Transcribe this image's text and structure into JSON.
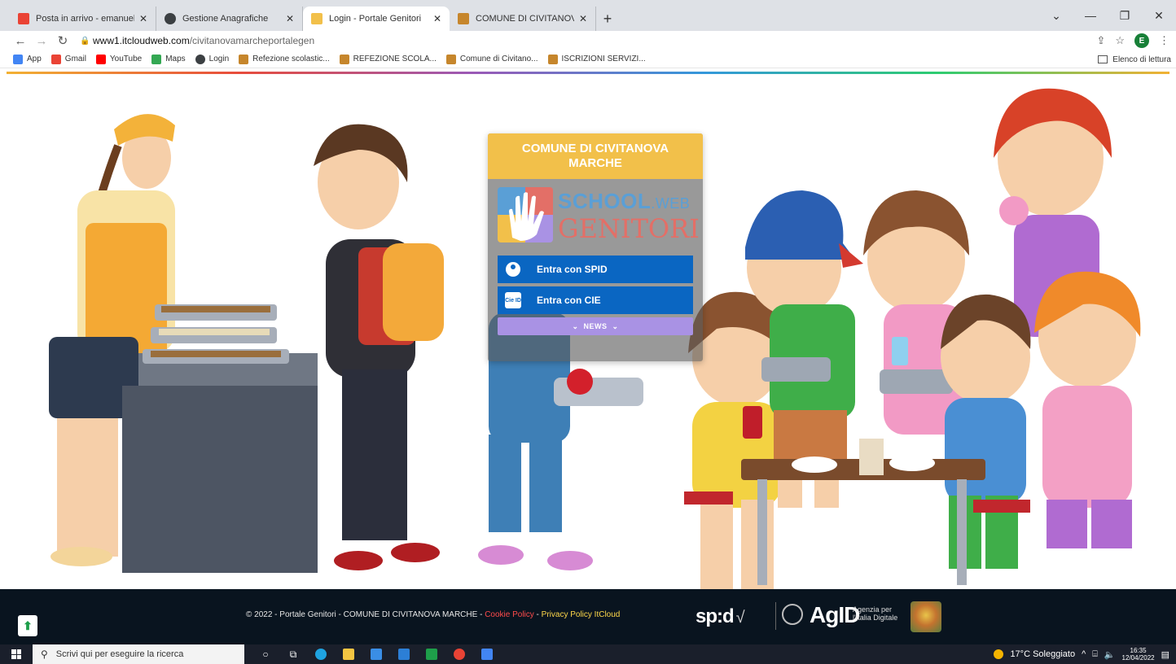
{
  "browser": {
    "tabs": [
      {
        "title": "Posta in arrivo - emanuela.torres",
        "favicon_color": "#ea4335",
        "icon": "gmail-icon"
      },
      {
        "title": "Gestione Anagrafiche",
        "favicon_color": "#3c4043",
        "icon": "globe-icon"
      },
      {
        "title": "Login - Portale Genitori",
        "favicon_color": "#f2c04a",
        "icon": "portal-icon"
      },
      {
        "title": "COMUNE DI CIVITANOVA MARC",
        "favicon_color": "#c6862c",
        "icon": "crest-icon"
      }
    ],
    "new_tab_label": "+",
    "url_host": "www1.itcloudweb.com",
    "url_path": "/civitanovamarcheportalegen",
    "profile_initial": "E",
    "bookmarks": [
      {
        "label": "App",
        "color": "#4285f4",
        "icon": "apps-icon"
      },
      {
        "label": "Gmail",
        "color": "#ea4335",
        "icon": "gmail-icon"
      },
      {
        "label": "YouTube",
        "color": "#ff0000",
        "icon": "youtube-icon"
      },
      {
        "label": "Maps",
        "color": "#34a853",
        "icon": "maps-icon"
      },
      {
        "label": "Login",
        "color": "#3c4043",
        "icon": "globe-icon"
      },
      {
        "label": "Refezione scolastic...",
        "color": "#c6862c",
        "icon": "crest-icon"
      },
      {
        "label": "REFEZIONE SCOLA...",
        "color": "#c6862c",
        "icon": "crest-icon"
      },
      {
        "label": "Comune di Civitano...",
        "color": "#c6862c",
        "icon": "crest-icon"
      },
      {
        "label": "ISCRIZIONI SERVIZI...",
        "color": "#c6862c",
        "icon": "crest-icon"
      }
    ],
    "reading_list_label": "Elenco di lettura"
  },
  "login_card": {
    "title": "COMUNE DI CIVITANOVA MARCHE",
    "logo_line1": "SCHOOL",
    "logo_line1_suffix": ".WEB",
    "logo_line2": "GENITORI",
    "spid_button": "Entra con SPID",
    "cie_button": "Entra con CIE",
    "cie_icon_text": "Cie ID",
    "news_button": "NEWS"
  },
  "footer": {
    "copyright": "© 2022 - Portale Genitori - COMUNE DI CIVITANOVA MARCHE - ",
    "cookie_policy": "Cookie Policy",
    "separator": " - ",
    "privacy_policy": "Privacy Policy ItCloud",
    "spid_logo": "sp:d",
    "agid_logo": "AgID",
    "agid_subtitle": "Agenzia per l'Italia Digitale"
  },
  "taskbar": {
    "search_placeholder": "Scrivi qui per eseguire la ricerca",
    "weather": "17°C  Soleggiato",
    "time": "16:35",
    "date": "12/04/2022"
  },
  "colors": {
    "card_header": "#f2c04a",
    "button_blue": "#0a66c2",
    "news_purple": "#a992e4",
    "footer_bg": "#09141f"
  }
}
